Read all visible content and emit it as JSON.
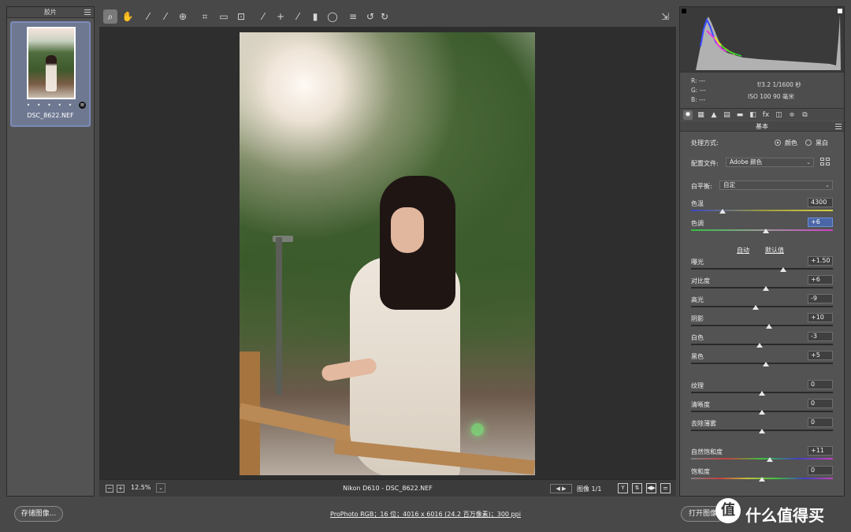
{
  "filmstrip": {
    "title": "胶片",
    "item": {
      "filename": "DSC_8622.NEF",
      "rating": "• • • • •"
    }
  },
  "toolbar": {
    "tools": [
      {
        "icon": "zoom-tool-icon",
        "glyph": "⌕"
      },
      {
        "icon": "hand-tool-icon",
        "glyph": "✋"
      },
      {
        "icon": "white-balance-tool-icon",
        "glyph": "⁄"
      },
      {
        "icon": "color-sampler-tool-icon",
        "glyph": "⁄"
      },
      {
        "icon": "targeted-adjustment-tool-icon",
        "glyph": "⊕"
      },
      {
        "icon": "crop-tool-icon",
        "glyph": "⌗"
      },
      {
        "icon": "straighten-tool-icon",
        "glyph": "▭"
      },
      {
        "icon": "transform-tool-icon",
        "glyph": "⊡"
      },
      {
        "icon": "spot-removal-tool-icon",
        "glyph": "⁄"
      },
      {
        "icon": "red-eye-tool-icon",
        "glyph": "+"
      },
      {
        "icon": "adjustment-brush-icon",
        "glyph": "⁄"
      },
      {
        "icon": "graduated-filter-icon",
        "glyph": "▮"
      },
      {
        "icon": "radial-filter-icon",
        "glyph": "◯"
      },
      {
        "icon": "preferences-icon",
        "glyph": "≡"
      },
      {
        "icon": "rotate-left-icon",
        "glyph": "↺"
      },
      {
        "icon": "rotate-right-icon",
        "glyph": "↻"
      }
    ],
    "fullscreen_icon": "fullscreen-icon"
  },
  "statusbar": {
    "zoom": "12.5%",
    "filename": "Nikon D610 -  DSC_8622.NEF",
    "image_count": "图像 1/1",
    "zoom_out": "−",
    "zoom_in": "+",
    "zoom_caret": "⌄",
    "nav": "◀ ▶",
    "view_buttons": [
      "Y",
      "⇅",
      "◀▶",
      "⚌"
    ]
  },
  "histogram_info": {
    "r": "R:   ---",
    "g": "G:   ---",
    "b": "B:   ---",
    "aperture_shutter": "f/3.2   1/1600 秒",
    "iso_focal": "ISO 100    90 毫米"
  },
  "panel_tabs": [
    {
      "icon": "basic-tab-icon",
      "glyph": "✹"
    },
    {
      "icon": "tone-curve-tab-icon",
      "glyph": "▦"
    },
    {
      "icon": "detail-tab-icon",
      "glyph": "▲"
    },
    {
      "icon": "hsl-tab-icon",
      "glyph": "▤"
    },
    {
      "icon": "split-toning-tab-icon",
      "glyph": "▬"
    },
    {
      "icon": "lens-corrections-tab-icon",
      "glyph": "◧"
    },
    {
      "icon": "effects-tab-icon",
      "glyph": "fx"
    },
    {
      "icon": "calibration-tab-icon",
      "glyph": "◫"
    },
    {
      "icon": "presets-tab-icon",
      "glyph": "≑"
    },
    {
      "icon": "snapshots-tab-icon",
      "glyph": "⧉"
    }
  ],
  "basic": {
    "title": "基本",
    "treatment_label": "处理方式:",
    "treatment_color": "颜色",
    "treatment_bw": "黑白",
    "profile_label": "配置文件:",
    "profile_value": "Adobe 颜色",
    "wb_label": "白平衡:",
    "wb_value": "自定",
    "auto": "自动",
    "default": "默认值",
    "sliders": [
      {
        "key": "temp",
        "label": "色温",
        "value": "4300",
        "pos": 0.22,
        "gradient": "linear-gradient(90deg,#3848c8,#9a9a40,#d8d040)"
      },
      {
        "key": "tint",
        "label": "色调",
        "value": "+6",
        "pos": 0.53,
        "gradient": "linear-gradient(90deg,#30c040,#9a9a9a,#d040c8)",
        "focus": true
      },
      {
        "key": "exposure",
        "label": "曝光",
        "value": "+1.50",
        "pos": 0.65
      },
      {
        "key": "contrast",
        "label": "对比度",
        "value": "+6",
        "pos": 0.53
      },
      {
        "key": "highlights",
        "label": "高光",
        "value": "-9",
        "pos": 0.455
      },
      {
        "key": "shadows",
        "label": "阴影",
        "value": "+10",
        "pos": 0.55
      },
      {
        "key": "whites",
        "label": "白色",
        "value": "-3",
        "pos": 0.485
      },
      {
        "key": "blacks",
        "label": "黑色",
        "value": "+5",
        "pos": 0.525
      },
      {
        "key": "texture",
        "label": "纹理",
        "value": "0",
        "pos": 0.5
      },
      {
        "key": "clarity",
        "label": "清晰度",
        "value": "0",
        "pos": 0.5
      },
      {
        "key": "dehaze",
        "label": "去除薄雾",
        "value": "0",
        "pos": 0.5
      },
      {
        "key": "vibrance",
        "label": "自然饱和度",
        "value": "+11",
        "pos": 0.555,
        "gradient": "linear-gradient(90deg,#808080,#c04040,#40c040,#4040c0,#c040c0)"
      },
      {
        "key": "saturation",
        "label": "饱和度",
        "value": "0",
        "pos": 0.5,
        "gradient": "linear-gradient(90deg,#808080,#c04040,#c0c040,#40c040,#4040c0,#c040c0)"
      }
    ]
  },
  "bottom": {
    "save_label": "存储图像...",
    "file_info": "ProPhoto RGB；16 位；4016 x 6016 (24.2 百万像素)；300 ppi",
    "open_label": "打开图像",
    "watermark_glyph": "值",
    "watermark_text": "什么值得买"
  }
}
